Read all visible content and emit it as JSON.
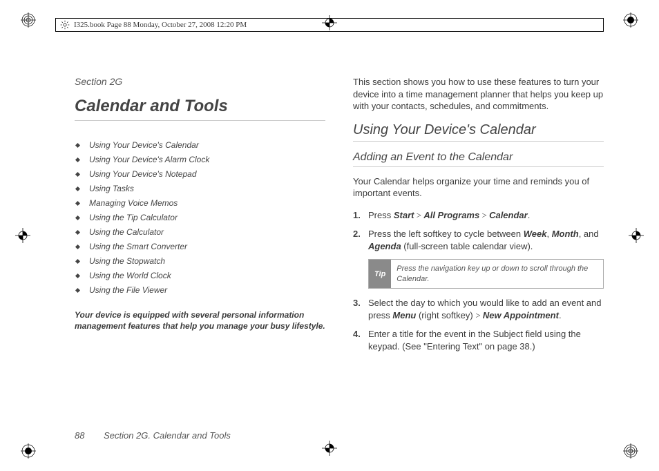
{
  "header": {
    "text": "I325.book  Page 88  Monday, October 27, 2008  12:20 PM"
  },
  "left": {
    "section_label": "Section 2G",
    "title": "Calendar and Tools",
    "toc": [
      "Using Your Device's Calendar",
      "Using Your Device's Alarm Clock",
      "Using Your Device's Notepad",
      "Using Tasks",
      "Managing Voice Memos",
      "Using the Tip Calculator",
      "Using the Calculator",
      "Using the Smart Converter",
      "Using the Stopwatch",
      "Using the World Clock",
      "Using the File Viewer"
    ],
    "blurb": "Your device is equipped with several personal information management features that help you manage your busy lifestyle."
  },
  "right": {
    "intro": "This section shows you how to use these features to turn your device into a time management planner that helps you keep up with your contacts, schedules, and commitments.",
    "h2": "Using Your Device's Calendar",
    "h3": "Adding an Event to the Calendar",
    "p1": "Your Calendar helps organize your time and reminds you of important events.",
    "step1_pre": "Press ",
    "step1_k1": "Start",
    "step1_gt1": " > ",
    "step1_k2": "All Programs",
    "step1_gt2": " > ",
    "step1_k3": "Calendar",
    "step1_post": ".",
    "step2_pre": "Press the left softkey to cycle between ",
    "step2_k1": "Week",
    "step2_c1": ", ",
    "step2_k2": "Month",
    "step2_c2": ", and ",
    "step2_k3": "Agenda",
    "step2_post": " (full-screen table calendar view).",
    "tip_label": "Tip",
    "tip_text": "Press the navigation key up or down to scroll through the Calendar.",
    "step3_pre": "Select the day to which you would like to add an event and press ",
    "step3_k1": "Menu",
    "step3_mid": " (right softkey) ",
    "step3_gt": "> ",
    "step3_k2": "New Appointment",
    "step3_post": ".",
    "step4": "Enter a title for the event in the Subject field using the keypad. (See \"Entering Text\" on page 38.)"
  },
  "footer": {
    "page_number": "88",
    "section": "Section 2G. Calendar and Tools"
  }
}
